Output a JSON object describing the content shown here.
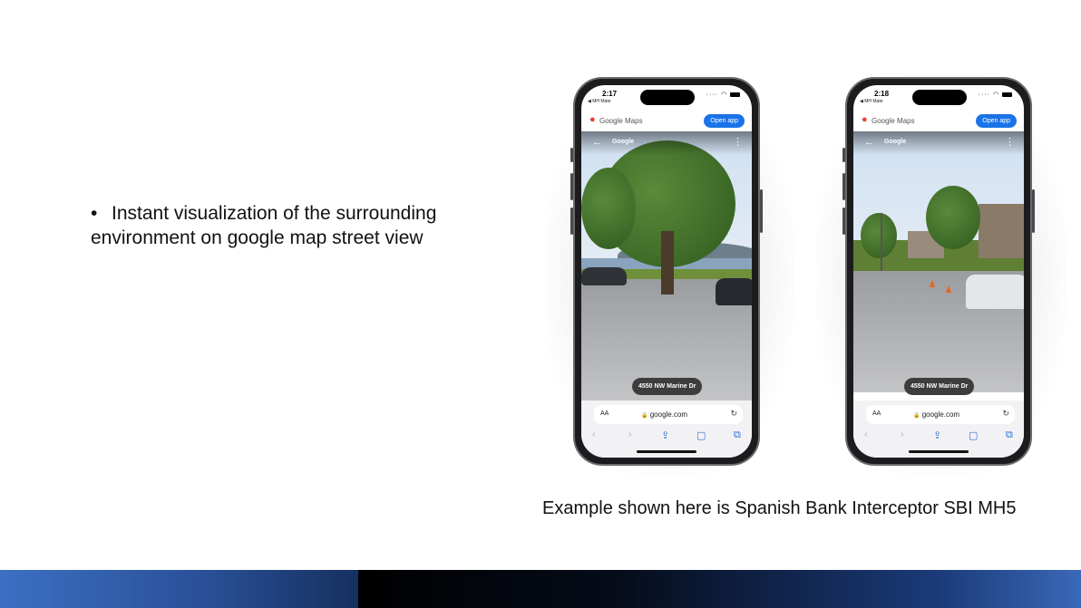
{
  "slide": {
    "bullet_line1": "Instant visualization of the surrounding",
    "bullet_line2": "environment on google map street view",
    "bullet_marker": "•",
    "caption": "Example shown here is Spanish Bank Interceptor SBI MH5"
  },
  "phones": [
    {
      "time": "2:17",
      "carrier": "◀ MH Mate",
      "app_name": "Google Maps",
      "open_app_label": "Open app",
      "streetview_label": "Google",
      "address": "4550 NW Marine Dr",
      "aa_label": "AA",
      "url": "google.com"
    },
    {
      "time": "2:18",
      "carrier": "◀ MH Mate",
      "app_name": "Google Maps",
      "open_app_label": "Open app",
      "streetview_label": "Google",
      "address": "4550 NW Marine Dr",
      "aa_label": "AA",
      "url": "google.com"
    }
  ],
  "icons": {
    "back": "←",
    "menu": "⋮",
    "lock": "🔒",
    "reload": "↻",
    "nav_back": "‹",
    "nav_forward": "›",
    "share": "⇪",
    "bookmarks": "📖",
    "tabs": "⧉",
    "map_pin": "⬤"
  },
  "colors": {
    "open_app_bg": "#1a73e8",
    "footer_blue": "#3c6fc2",
    "footer_dark": "#000000",
    "safari_blue": "#2a6fd6"
  }
}
